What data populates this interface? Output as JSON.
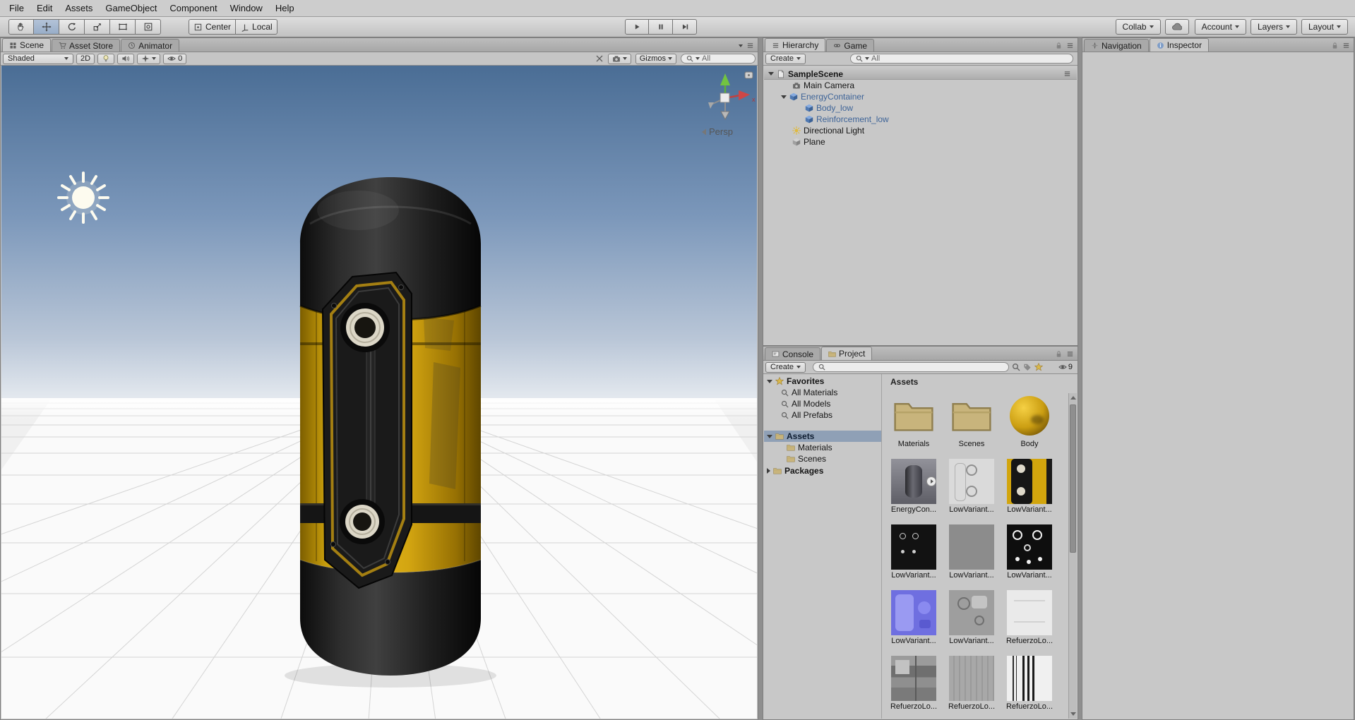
{
  "menu_bar": {
    "items": [
      "File",
      "Edit",
      "Assets",
      "GameObject",
      "Component",
      "Window",
      "Help"
    ]
  },
  "toolbar": {
    "pivot": "Center",
    "space": "Local",
    "collab": "Collab",
    "account": "Account",
    "layers": "Layers",
    "layout": "Layout"
  },
  "scene": {
    "tabs": [
      "Scene",
      "Asset Store",
      "Animator"
    ],
    "shading_mode": "Shaded",
    "toggle_2d": "2D",
    "effects_count": "0",
    "gizmos_label": "Gizmos",
    "search_value": "All",
    "persp_label": "Persp"
  },
  "hierarchy": {
    "tabs": [
      "Hierarchy",
      "Game"
    ],
    "create_label": "Create",
    "search_value": "All",
    "tree": [
      {
        "label": "SampleScene"
      },
      {
        "label": "Main Camera"
      },
      {
        "label": "EnergyContainer"
      },
      {
        "label": "Body_low"
      },
      {
        "label": "Reinforcement_low"
      },
      {
        "label": "Directional Light"
      },
      {
        "label": "Plane"
      }
    ]
  },
  "inspector": {
    "tabs": [
      "Navigation",
      "Inspector"
    ]
  },
  "project": {
    "tabs": [
      "Console",
      "Project"
    ],
    "create_label": "Create",
    "hidden_count": "9",
    "breadcrumb": "Assets",
    "sidebar": {
      "favorites_label": "Favorites",
      "favorites": [
        "All Materials",
        "All Models",
        "All Prefabs"
      ],
      "assets_label": "Assets",
      "assets_children": [
        "Materials",
        "Scenes"
      ],
      "packages_label": "Packages"
    },
    "grid": [
      {
        "label": "Materials"
      },
      {
        "label": "Scenes"
      },
      {
        "label": "Body"
      },
      {
        "label": "EnergyCon..."
      },
      {
        "label": "LowVariant..."
      },
      {
        "label": "LowVariant..."
      },
      {
        "label": "LowVariant..."
      },
      {
        "label": "LowVariant..."
      },
      {
        "label": "LowVariant..."
      },
      {
        "label": "LowVariant..."
      },
      {
        "label": "LowVariant..."
      },
      {
        "label": "RefuerzoLo..."
      },
      {
        "label": "RefuerzoLo..."
      },
      {
        "label": "RefuerzoLo..."
      },
      {
        "label": "RefuerzoLo..."
      }
    ]
  },
  "colors": {
    "prefab_text": "#3e6498",
    "selection": "#8fa0b6",
    "accent_yellow": "#d3a511",
    "sky_top": "#4a6d95",
    "sky_horizon": "#e4e9ef"
  },
  "icons": {
    "search": "magnifier",
    "folder": "folder-shape",
    "star": "★",
    "eye": "eye-shape",
    "lock": "padlock",
    "pane-menu": "≡",
    "caret": "▾",
    "cloud": "cloud-shape",
    "play": "▶",
    "pause": "❚❚",
    "step": "▶|",
    "light": "sun-rays",
    "camera": "camera-body",
    "cube": "iso-cube",
    "hand": "palm",
    "move": "cross-arrows",
    "rotate": "circular-arrow",
    "scale": "square-diagonal-arrow",
    "rect-tool": "rectangle-corners",
    "transform": "square-with-circle"
  }
}
